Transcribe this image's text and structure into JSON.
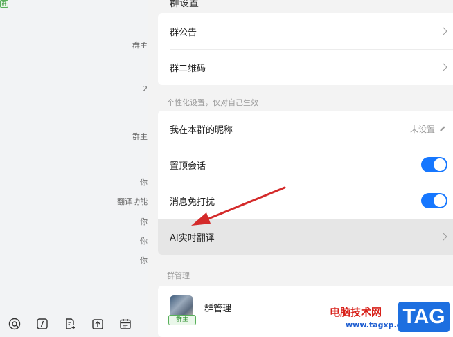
{
  "chat": {
    "fragments": [
      "群主",
      "2",
      "群主",
      "你",
      "翻译功能",
      "你",
      "你",
      "你"
    ]
  },
  "settings": {
    "title": "群设置",
    "top_items": [
      "群公告",
      "群二维码"
    ],
    "personal_hint": "个性化设置，仅对自己生效",
    "nickname_label": "我在本群的昵称",
    "nickname_value": "未设置",
    "pin_label": "置顶会话",
    "pin_on": true,
    "mute_label": "消息免打扰",
    "mute_on": true,
    "ai_translate_label": "AI实时翻译",
    "manage_hint": "群管理",
    "admin_label": "群管理",
    "admin_badge": "群主"
  },
  "watermark": {
    "site": "电脑技术网",
    "url": "www.tagxp.com",
    "tag": "TAG"
  },
  "colors": {
    "accent": "#1677ff",
    "annotation": "#d42a2a"
  }
}
